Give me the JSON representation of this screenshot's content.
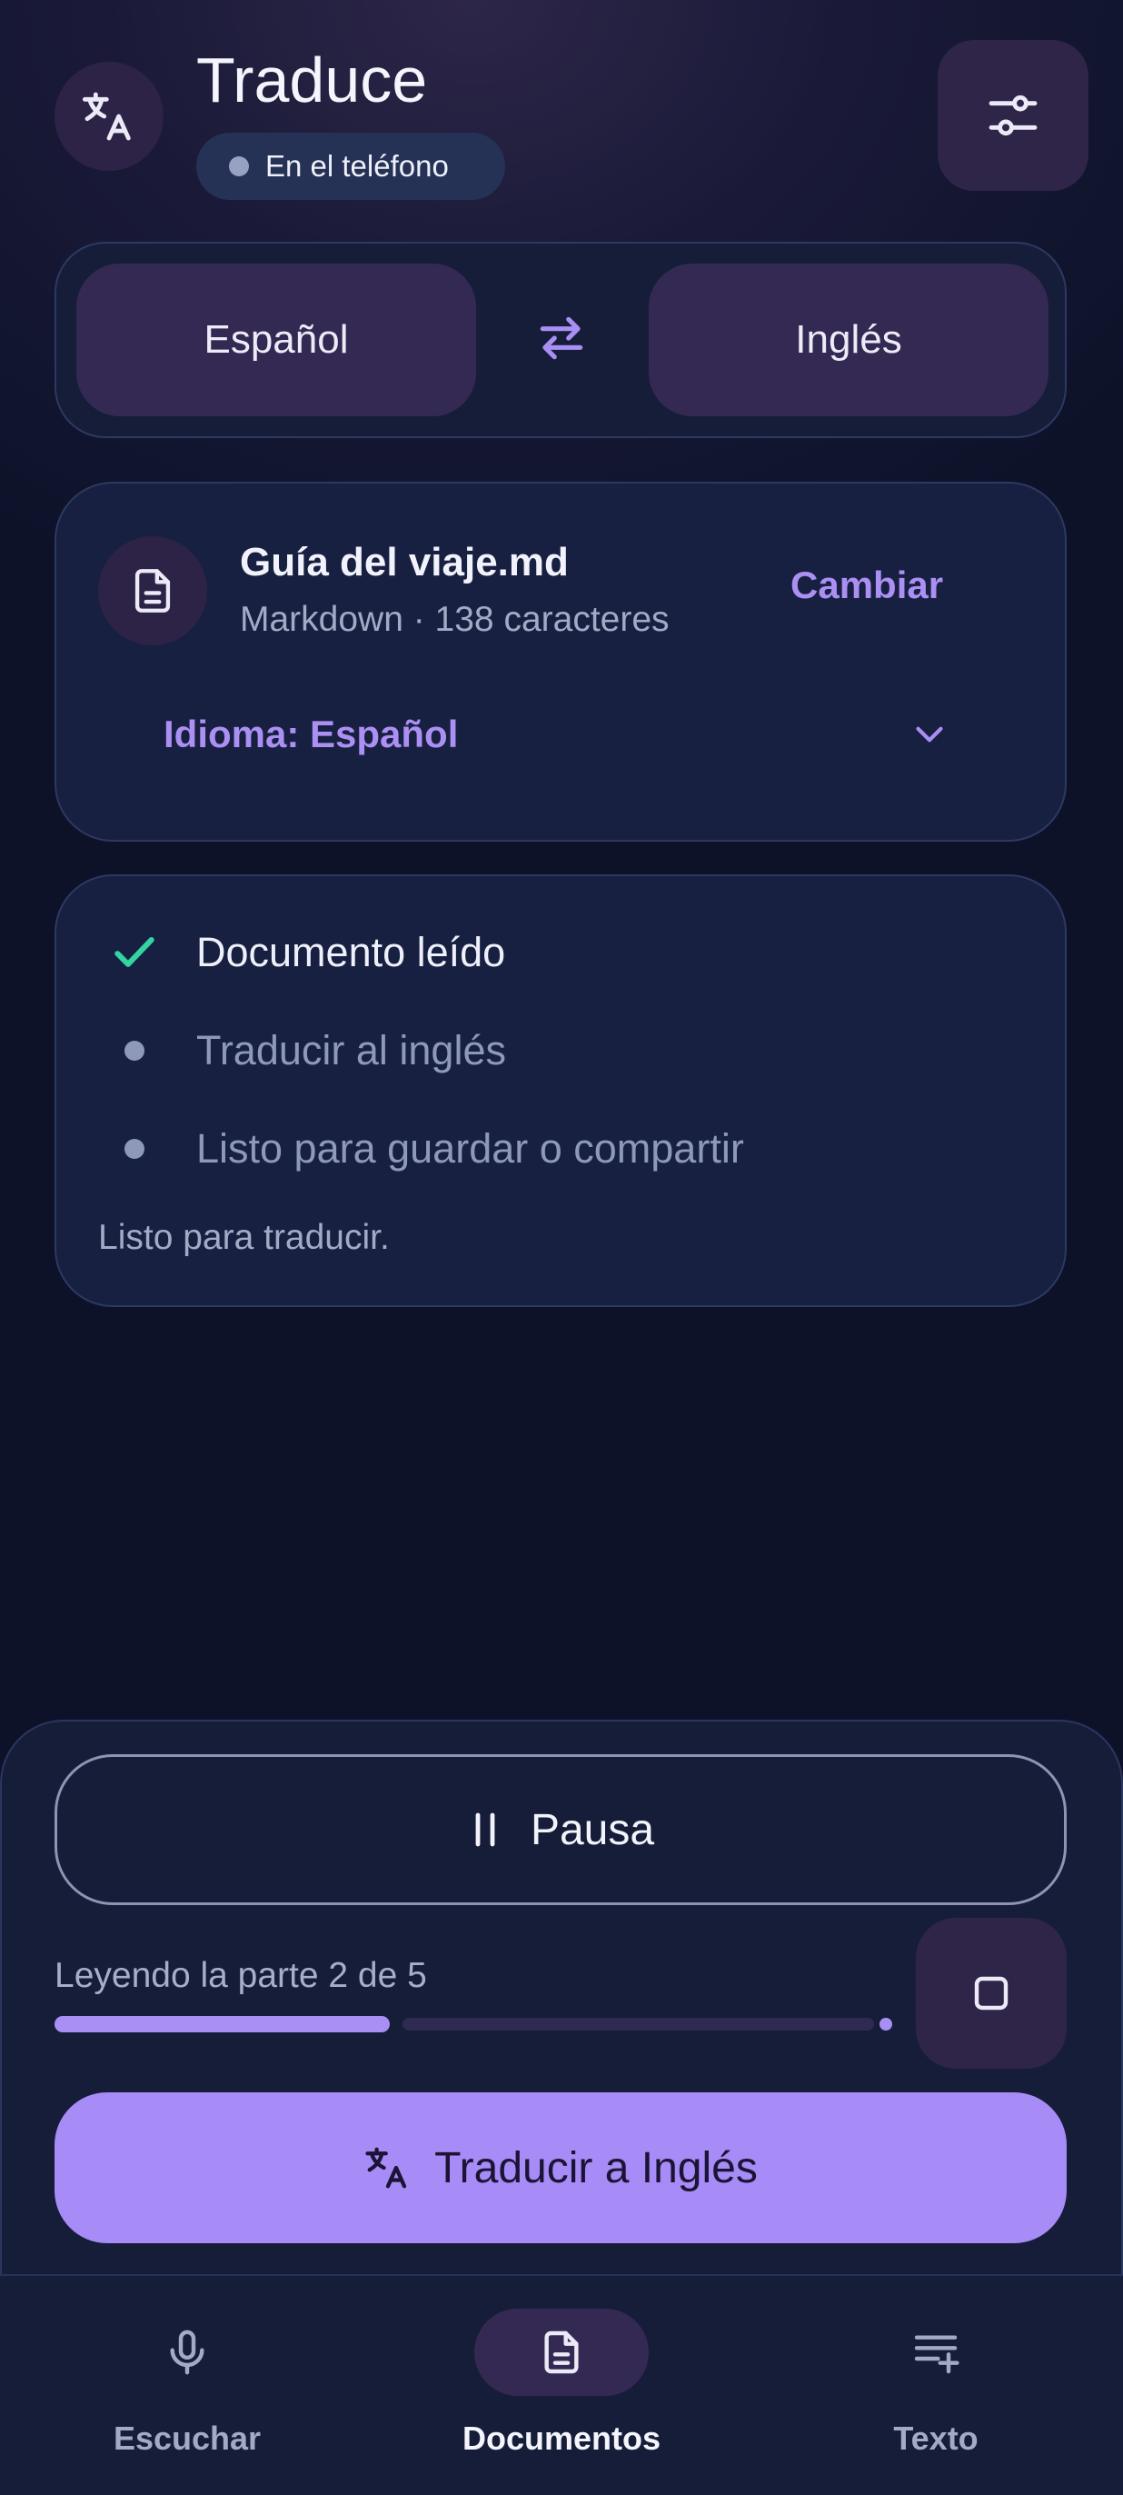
{
  "header": {
    "app_title": "Traduce",
    "badge_text": "En el teléfono",
    "icons": {
      "logo": "translate-icon",
      "settings": "sliders-icon"
    }
  },
  "languages": {
    "source": "Español",
    "target": "Inglés",
    "swap_icon": "swap-arrows-icon"
  },
  "document": {
    "name": "Guía del viaje.md",
    "meta": "Markdown · 138 caracteres",
    "change_label": "Cambiar",
    "language_select": "Idioma: Español"
  },
  "steps": [
    {
      "label": "Documento leído",
      "state": "done"
    },
    {
      "label": "Traducir al inglés",
      "state": "pending"
    },
    {
      "label": "Listo para guardar o compartir",
      "state": "pending"
    }
  ],
  "status_message": "Listo para traducir.",
  "playback": {
    "pause_label": "Pausa",
    "progress_label": "Leyendo la parte 2 de 5",
    "progress": 0.4
  },
  "translate_button": "Traducir a Inglés",
  "nav": [
    {
      "label": "Escuchar",
      "icon": "microphone-icon",
      "active": false
    },
    {
      "label": "Documentos",
      "icon": "document-icon",
      "active": true
    },
    {
      "label": "Texto",
      "icon": "text-add-icon",
      "active": false
    }
  ],
  "colors": {
    "accent": "#a78bf6",
    "success": "#34d3a4",
    "background": "#0c1127",
    "card": "#172040"
  }
}
